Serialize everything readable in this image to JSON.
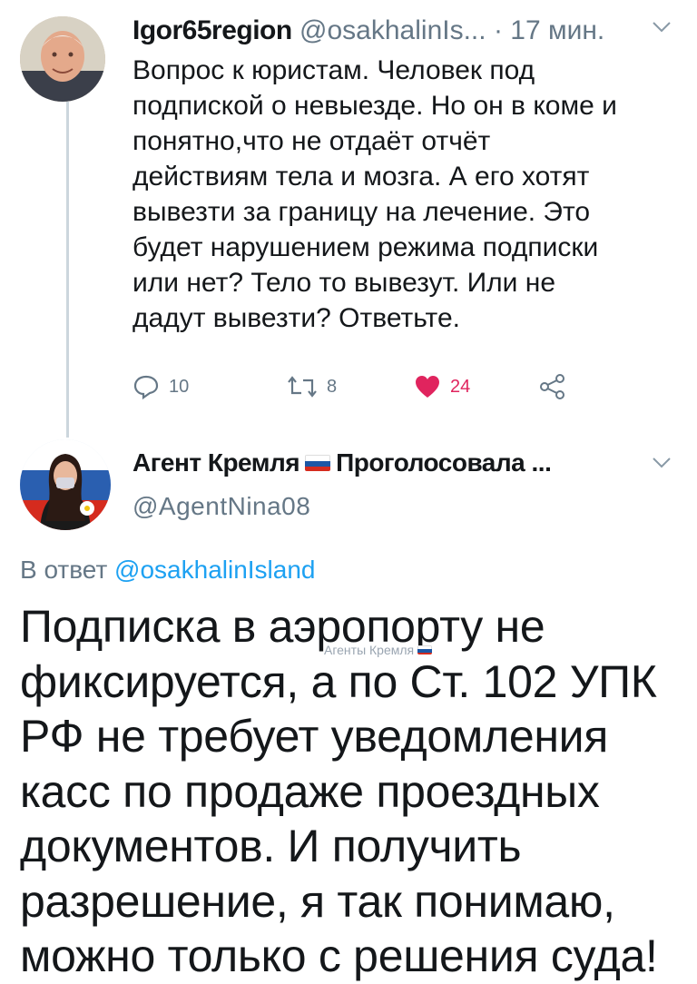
{
  "tweet1": {
    "display_name": "Igor65region",
    "handle": "@osakhalinIs...",
    "time": "· 17 мин.",
    "text": "Вопрос к юристам. Человек под\nподпиской о невыезде. Но он в коме и\nпонятно,что не отдаёт отчёт\nдействиям тела и мозга. А его хотят\nвывезти за границу на лечение. Это\nбудет нарушением режима подписки\nили нет? Тело то вывезут. Или не\nдадут вывезти? Ответьте.",
    "replies": "10",
    "retweets": "8",
    "likes": "24",
    "icons": {
      "reply": "reply-icon",
      "retweet": "retweet-icon",
      "like": "heart-icon",
      "share": "share-icon",
      "menu": "chevron-down-icon"
    }
  },
  "tweet2": {
    "display_name_part1": "Агент Кремля",
    "display_name_part2": "Проголосовала ...",
    "handle": "@AgentNina08",
    "replying_label": "В ответ",
    "replying_to": "@osakhalinIsland",
    "text": "Подписка в аэропорту не\nфиксируется, а по Ст. 102 УПК\nРФ не требует уведомления\nкасс по продаже проездных\nдокументов. И получить\nразрешение, я так понимаю,\nможно только с решения суда!"
  },
  "watermark": {
    "text": "Агенты Кремля"
  },
  "colors": {
    "text": "#14171a",
    "secondary": "#657786",
    "link": "#1da1f2",
    "like": "#e0245e",
    "thread_line": "#ccd6dd",
    "flag": [
      "#ffffff",
      "#1c57a5",
      "#d52b1e"
    ]
  }
}
